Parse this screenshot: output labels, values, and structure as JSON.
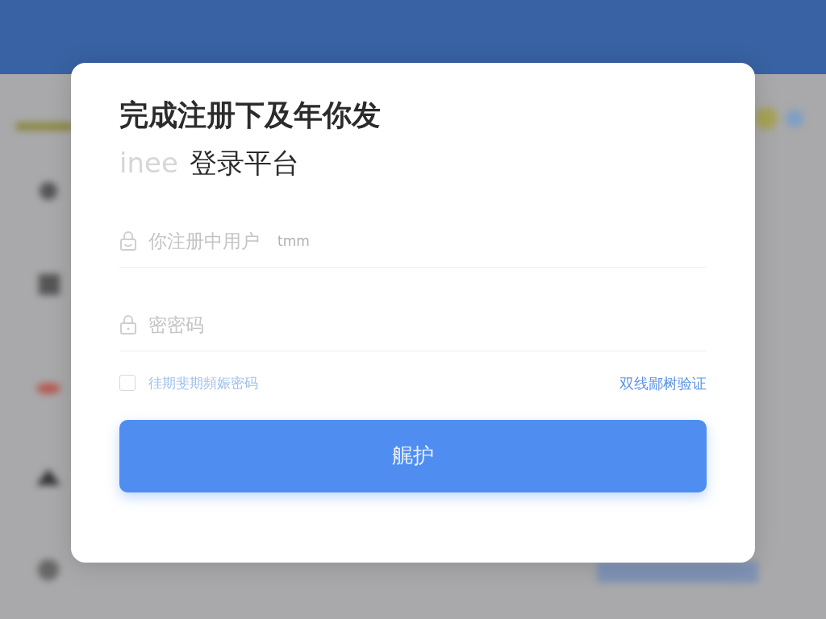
{
  "dialog": {
    "title": "完成注册下及年你发",
    "subtitle": {
      "prefix": "inee",
      "text": "登录平台"
    },
    "fields": [
      {
        "kind": "username",
        "placeholder": "你注册中用户",
        "hint": "tmm"
      },
      {
        "kind": "password",
        "placeholder": "密密码"
      }
    ],
    "remember": {
      "label": "徍期斐期頻娠密码",
      "checked": false
    },
    "link": "双线鄙树验证",
    "submit": "艉护"
  }
}
